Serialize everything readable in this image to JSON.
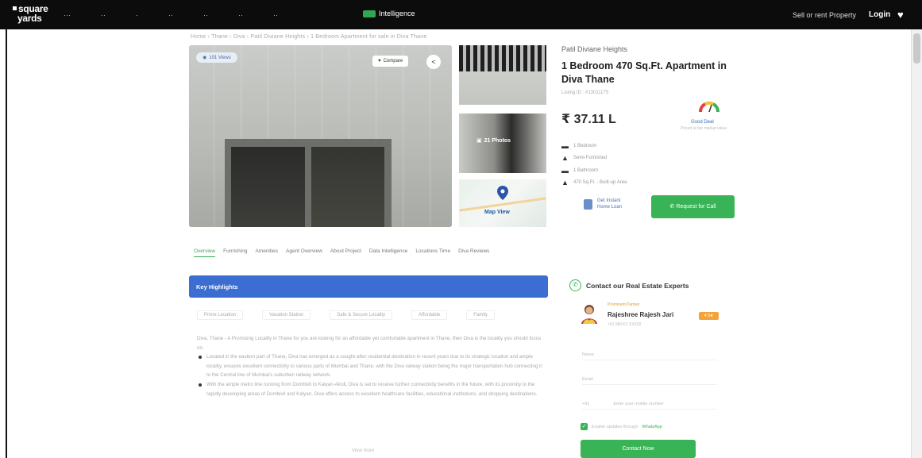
{
  "nav": {
    "logo_line1": "square",
    "logo_line2": "yards",
    "items": [
      "···",
      "··",
      "·",
      "··",
      "··",
      "··",
      "··"
    ],
    "intelligence_label": "Intelligence",
    "sell_label": "Sell or rent Property",
    "login_label": "Login"
  },
  "breadcrumb": "Home › Thane › Diva › Patil Diviane Heights › 1 Bedroom Apartment for sale in Diva Thane",
  "gallery": {
    "views_label": "101 Views",
    "compare_label": "Compare",
    "photos_label": "21 Photos",
    "map_label": "Map View"
  },
  "listing": {
    "project_name": "Patil Diviane Heights",
    "title": "1 Bedroom 470 Sq.Ft. Apartment in Diva Thane",
    "listing_id": "Listing ID : #13011175",
    "price": "₹ 37.11 L",
    "gauge_label": "Good Deal",
    "gauge_sub": "Priced at fair market value",
    "specs": [
      {
        "icon": "bed-icon",
        "text": "1 Bedroom"
      },
      {
        "icon": "furnishing-icon",
        "text": "Semi-Furnished"
      },
      {
        "icon": "bath-icon",
        "text": "1 Bathroom"
      },
      {
        "icon": "area-icon",
        "text": "470 Sq.Ft. - Built-up Area"
      }
    ],
    "loan_text1": "Get Instant",
    "loan_text2": "Home Loan",
    "callback_label": "Request for Call"
  },
  "tabs": [
    "Overview",
    "Furnishing",
    "Amenities",
    "Agent Overview",
    "About Project",
    "Data Intelligence",
    "Locations Time",
    "Diva Reviews"
  ],
  "highlights": {
    "header": "Key Highlights",
    "chips": [
      "Prime Location",
      "Vacation Station",
      "Safe & Secure Locality",
      "Affordable",
      "Family"
    ],
    "intro": "Diva, Thane - A Promising Locality in Thane for you are looking for an affordable yet comfortable apartment in Thane, then Diva is the locality you should focus on.",
    "bullets": [
      "Located in the eastern part of Thane, Diva has emerged as a sought-after residential destination in recent years due to its strategic location and ample locality, ensures excellent connectivity to various parts of Mumbai and Thane, with the Diva railway station being the major transportation hub connecting it to the Central line of Mumbai's suburban railway network.",
      "With the ample metro line running from Dombivli to Kalyan-Airoli, Diva is set to receive further connectivity benefits in the future, with its proximity to the rapidly developing areas of Dombivli and Kalyan. Diva offers access to excellent healthcare facilities, educational institutions, and shopping destinations."
    ],
    "view_more": "View more"
  },
  "contact": {
    "title": "Contact our Real Estate Experts",
    "agent_role": "Prominent Partner",
    "agent_name": "Rajeshree Rajesh Jari",
    "agent_badge": "4.9★",
    "agent_sub": "+91 98XXX XXX92",
    "name_placeholder": "Name",
    "email_placeholder": "Email",
    "phone_code": "+91",
    "phone_placeholder": "Enter your mobile number",
    "whatsapp_text": "Enable updates through",
    "whatsapp_link": "WhatsApp",
    "submit_label": "Contact Now"
  }
}
